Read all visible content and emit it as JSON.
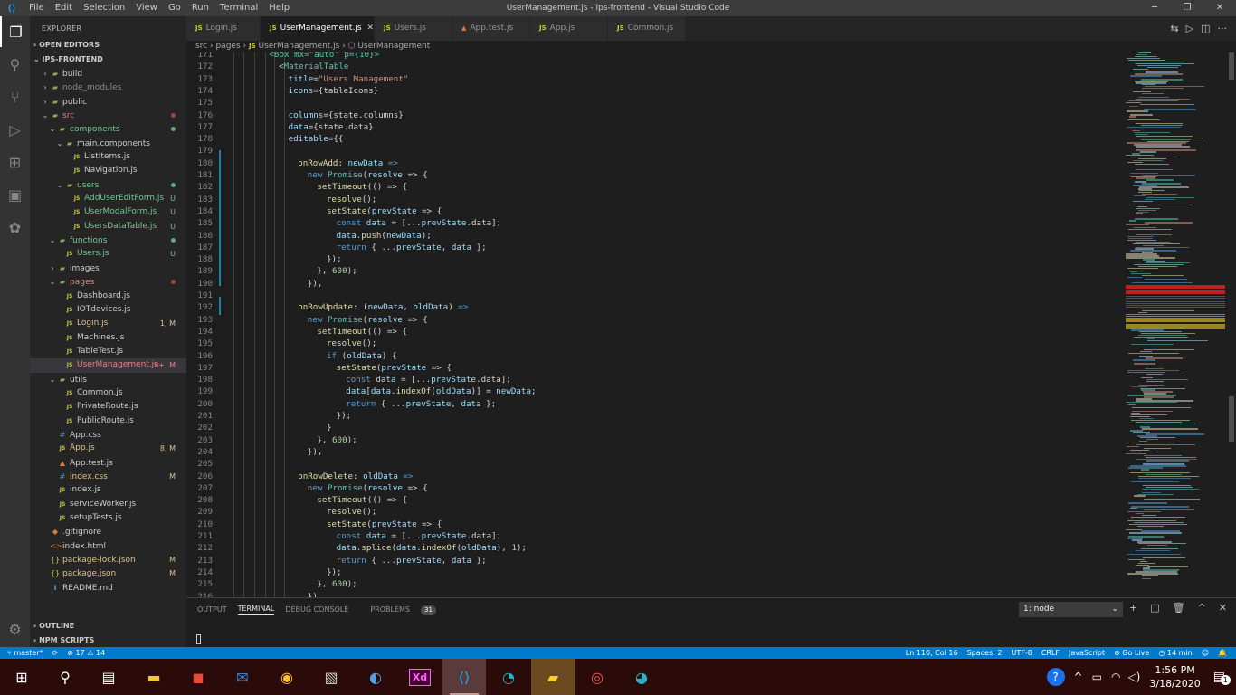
{
  "window": {
    "menu": [
      "File",
      "Edit",
      "Selection",
      "View",
      "Go",
      "Run",
      "Terminal",
      "Help"
    ],
    "title": "UserManagement.js - ips-frontend - Visual Studio Code"
  },
  "explorer": {
    "header": "EXPLORER",
    "open_editors": "OPEN EDITORS",
    "project": "IPS-FRONTEND",
    "outline": "OUTLINE",
    "npm_scripts": "NPM SCRIPTS",
    "tree": [
      {
        "label": "build",
        "type": "folder",
        "depth": 1,
        "open": false,
        "color": "#cccccc",
        "status": ""
      },
      {
        "label": "node_modules",
        "type": "folder",
        "depth": 1,
        "open": false,
        "color": "#8b8b8b",
        "status": ""
      },
      {
        "label": "public",
        "type": "folder",
        "depth": 1,
        "open": false,
        "color": "#cccccc",
        "status": ""
      },
      {
        "label": "src",
        "type": "folder",
        "depth": 1,
        "open": true,
        "color": "#e2817e",
        "status": "dot-red"
      },
      {
        "label": "components",
        "type": "folder",
        "depth": 2,
        "open": true,
        "color": "#73c991",
        "status": "dot-green"
      },
      {
        "label": "main.components",
        "type": "folder",
        "depth": 3,
        "open": true,
        "color": "#cccccc",
        "status": ""
      },
      {
        "label": "ListItems.js",
        "type": "file",
        "depth": 4,
        "color": "#cccccc",
        "status": ""
      },
      {
        "label": "Navigation.js",
        "type": "file",
        "depth": 4,
        "color": "#cccccc",
        "status": ""
      },
      {
        "label": "users",
        "type": "folder",
        "depth": 3,
        "open": true,
        "color": "#73c991",
        "status": "dot-green"
      },
      {
        "label": "AddUserEditForm.js",
        "type": "file",
        "depth": 4,
        "color": "#73c991",
        "status": "U"
      },
      {
        "label": "UserModalForm.js",
        "type": "file",
        "depth": 4,
        "color": "#73c991",
        "status": "U"
      },
      {
        "label": "UsersDataTable.js",
        "type": "file",
        "depth": 4,
        "color": "#73c991",
        "status": "U"
      },
      {
        "label": "functions",
        "type": "folder",
        "depth": 2,
        "open": true,
        "color": "#73c991",
        "status": "dot-green"
      },
      {
        "label": "Users.js",
        "type": "file",
        "depth": 3,
        "color": "#73c991",
        "status": "U"
      },
      {
        "label": "images",
        "type": "folder",
        "depth": 2,
        "open": false,
        "color": "#cccccc",
        "status": ""
      },
      {
        "label": "pages",
        "type": "folder",
        "depth": 2,
        "open": true,
        "color": "#e2817e",
        "status": "dot-red"
      },
      {
        "label": "Dashboard.js",
        "type": "file",
        "depth": 3,
        "color": "#cccccc",
        "status": ""
      },
      {
        "label": "IOTdevices.js",
        "type": "file",
        "depth": 3,
        "color": "#cccccc",
        "status": ""
      },
      {
        "label": "Login.js",
        "type": "file",
        "depth": 3,
        "color": "#e2c08d",
        "status": "1, M"
      },
      {
        "label": "Machines.js",
        "type": "file",
        "depth": 3,
        "color": "#cccccc",
        "status": ""
      },
      {
        "label": "TableTest.js",
        "type": "file",
        "depth": 3,
        "color": "#cccccc",
        "status": ""
      },
      {
        "label": "UserManagement.js",
        "type": "file",
        "depth": 3,
        "color": "#e2817e",
        "status": "9+, M",
        "selected": true
      },
      {
        "label": "utils",
        "type": "folder",
        "depth": 2,
        "open": true,
        "color": "#cccccc",
        "status": ""
      },
      {
        "label": "Common.js",
        "type": "file",
        "depth": 3,
        "color": "#cccccc",
        "status": ""
      },
      {
        "label": "PrivateRoute.js",
        "type": "file",
        "depth": 3,
        "color": "#cccccc",
        "status": ""
      },
      {
        "label": "PublicRoute.js",
        "type": "file",
        "depth": 3,
        "color": "#cccccc",
        "status": ""
      },
      {
        "label": "App.css",
        "type": "file",
        "depth": 2,
        "color": "#cccccc",
        "status": ""
      },
      {
        "label": "App.js",
        "type": "file",
        "depth": 2,
        "color": "#e2c08d",
        "status": "8, M"
      },
      {
        "label": "App.test.js",
        "type": "file",
        "depth": 2,
        "color": "#cccccc",
        "status": ""
      },
      {
        "label": "index.css",
        "type": "file",
        "depth": 2,
        "color": "#e2c08d",
        "status": "M"
      },
      {
        "label": "index.js",
        "type": "file",
        "depth": 2,
        "color": "#cccccc",
        "status": ""
      },
      {
        "label": "serviceWorker.js",
        "type": "file",
        "depth": 2,
        "color": "#cccccc",
        "status": ""
      },
      {
        "label": "setupTests.js",
        "type": "file",
        "depth": 2,
        "color": "#cccccc",
        "status": ""
      },
      {
        "label": ".gitignore",
        "type": "file",
        "depth": 1,
        "color": "#cccccc",
        "status": ""
      },
      {
        "label": "index.html",
        "type": "file",
        "depth": 1,
        "color": "#cccccc",
        "status": ""
      },
      {
        "label": "package-lock.json",
        "type": "file",
        "depth": 1,
        "color": "#e2c08d",
        "status": "M"
      },
      {
        "label": "package.json",
        "type": "file",
        "depth": 1,
        "color": "#e2c08d",
        "status": "M"
      },
      {
        "label": "README.md",
        "type": "file",
        "depth": 1,
        "color": "#cccccc",
        "status": ""
      }
    ]
  },
  "tabs": [
    {
      "label": "Login.js",
      "active": false,
      "warn": false
    },
    {
      "label": "UserManagement.js",
      "active": true,
      "warn": false
    },
    {
      "label": "Users.js",
      "active": false,
      "warn": false
    },
    {
      "label": "App.test.js",
      "active": false,
      "warn": true
    },
    {
      "label": "App.js",
      "active": false,
      "warn": false
    },
    {
      "label": "Common.js",
      "active": false,
      "warn": false
    }
  ],
  "breadcrumb": {
    "parts": [
      "src",
      "pages",
      "UserManagement.js",
      "UserManagement"
    ]
  },
  "code_lines": [
    {
      "n": "171",
      "indent": 4,
      "tokens": [
        [
          "<Box mx=\"auto\" p={10}>",
          "tag"
        ]
      ]
    },
    {
      "n": "172",
      "indent": 5,
      "tokens": [
        [
          "<",
          "plain"
        ],
        [
          "MaterialTable",
          "tag"
        ]
      ]
    },
    {
      "n": "173",
      "indent": 6,
      "tokens": [
        [
          "title",
          "var"
        ],
        [
          "=",
          "plain"
        ],
        [
          "\"Users Management\"",
          "str"
        ]
      ]
    },
    {
      "n": "174",
      "indent": 6,
      "tokens": [
        [
          "icons",
          "var"
        ],
        [
          "={tableIcons}",
          "plain"
        ]
      ]
    },
    {
      "n": "175",
      "indent": 0,
      "tokens": []
    },
    {
      "n": "176",
      "indent": 6,
      "tokens": [
        [
          "columns",
          "var"
        ],
        [
          "={state.columns}",
          "plain"
        ]
      ]
    },
    {
      "n": "177",
      "indent": 6,
      "tokens": [
        [
          "data",
          "var"
        ],
        [
          "={state.data}",
          "plain"
        ]
      ]
    },
    {
      "n": "178",
      "indent": 6,
      "tokens": [
        [
          "editable",
          "var"
        ],
        [
          "={{",
          "plain"
        ]
      ]
    },
    {
      "n": "179",
      "indent": 0,
      "tokens": []
    },
    {
      "n": "180",
      "indent": 7,
      "tokens": [
        [
          "onRowAdd",
          "fn"
        ],
        [
          ": ",
          "plain"
        ],
        [
          "newData",
          "var"
        ],
        [
          " =>",
          "kw"
        ]
      ]
    },
    {
      "n": "181",
      "indent": 8,
      "tokens": [
        [
          "new ",
          "kw"
        ],
        [
          "Promise",
          "tag"
        ],
        [
          "(",
          "plain"
        ],
        [
          "resolve",
          "var"
        ],
        [
          " => {",
          "plain"
        ]
      ]
    },
    {
      "n": "182",
      "indent": 9,
      "tokens": [
        [
          "setTimeout",
          "fn"
        ],
        [
          "(() => {",
          "plain"
        ]
      ]
    },
    {
      "n": "183",
      "indent": 10,
      "tokens": [
        [
          "resolve",
          "fn"
        ],
        [
          "();",
          "plain"
        ]
      ]
    },
    {
      "n": "184",
      "indent": 10,
      "tokens": [
        [
          "setState",
          "fn"
        ],
        [
          "(",
          "plain"
        ],
        [
          "prevState",
          "var"
        ],
        [
          " => {",
          "plain"
        ]
      ]
    },
    {
      "n": "185",
      "indent": 11,
      "tokens": [
        [
          "const ",
          "kw"
        ],
        [
          "data",
          "var"
        ],
        [
          " = [...",
          "plain"
        ],
        [
          "prevState",
          "var"
        ],
        [
          ".data];",
          "plain"
        ]
      ]
    },
    {
      "n": "186",
      "indent": 11,
      "tokens": [
        [
          "data",
          "var"
        ],
        [
          ".",
          "plain"
        ],
        [
          "push",
          "fn"
        ],
        [
          "(",
          "plain"
        ],
        [
          "newData",
          "var"
        ],
        [
          ");",
          "plain"
        ]
      ]
    },
    {
      "n": "187",
      "indent": 11,
      "tokens": [
        [
          "return ",
          "kw"
        ],
        [
          "{ ...",
          "plain"
        ],
        [
          "prevState",
          "var"
        ],
        [
          ", ",
          "plain"
        ],
        [
          "data",
          "var"
        ],
        [
          " };",
          "plain"
        ]
      ]
    },
    {
      "n": "188",
      "indent": 10,
      "tokens": [
        [
          "});",
          "plain"
        ]
      ]
    },
    {
      "n": "189",
      "indent": 9,
      "tokens": [
        [
          "}, ",
          "plain"
        ],
        [
          "600",
          "num"
        ],
        [
          ");",
          "plain"
        ]
      ]
    },
    {
      "n": "190",
      "indent": 8,
      "tokens": [
        [
          "}),",
          "plain"
        ]
      ]
    },
    {
      "n": "191",
      "indent": 0,
      "tokens": []
    },
    {
      "n": "192",
      "indent": 7,
      "tokens": [
        [
          "onRowUpdate",
          "fn"
        ],
        [
          ": (",
          "plain"
        ],
        [
          "newData",
          "var"
        ],
        [
          ", ",
          "plain"
        ],
        [
          "oldData",
          "var"
        ],
        [
          ") ",
          "plain"
        ],
        [
          "=>",
          "kw"
        ]
      ]
    },
    {
      "n": "193",
      "indent": 8,
      "tokens": [
        [
          "new ",
          "kw"
        ],
        [
          "Promise",
          "tag"
        ],
        [
          "(",
          "plain"
        ],
        [
          "resolve",
          "var"
        ],
        [
          " => {",
          "plain"
        ]
      ]
    },
    {
      "n": "194",
      "indent": 9,
      "tokens": [
        [
          "setTimeout",
          "fn"
        ],
        [
          "(() => {",
          "plain"
        ]
      ]
    },
    {
      "n": "195",
      "indent": 10,
      "tokens": [
        [
          "resolve",
          "fn"
        ],
        [
          "();",
          "plain"
        ]
      ]
    },
    {
      "n": "196",
      "indent": 10,
      "tokens": [
        [
          "if ",
          "kw"
        ],
        [
          "(",
          "plain"
        ],
        [
          "oldData",
          "var"
        ],
        [
          ") {",
          "plain"
        ]
      ]
    },
    {
      "n": "197",
      "indent": 11,
      "tokens": [
        [
          "setState",
          "fn"
        ],
        [
          "(",
          "plain"
        ],
        [
          "prevState",
          "var"
        ],
        [
          " => {",
          "plain"
        ]
      ]
    },
    {
      "n": "198",
      "indent": 12,
      "tokens": [
        [
          "const ",
          "kw"
        ],
        [
          "data",
          "var"
        ],
        [
          " = [...",
          "plain"
        ],
        [
          "prevState",
          "var"
        ],
        [
          ".data];",
          "plain"
        ]
      ]
    },
    {
      "n": "199",
      "indent": 12,
      "tokens": [
        [
          "data",
          "var"
        ],
        [
          "[",
          "plain"
        ],
        [
          "data",
          "var"
        ],
        [
          ".",
          "plain"
        ],
        [
          "indexOf",
          "fn"
        ],
        [
          "(",
          "plain"
        ],
        [
          "oldData",
          "var"
        ],
        [
          ")] = ",
          "plain"
        ],
        [
          "newData",
          "var"
        ],
        [
          ";",
          "plain"
        ]
      ]
    },
    {
      "n": "200",
      "indent": 12,
      "tokens": [
        [
          "return ",
          "kw"
        ],
        [
          "{ ...",
          "plain"
        ],
        [
          "prevState",
          "var"
        ],
        [
          ", ",
          "plain"
        ],
        [
          "data",
          "var"
        ],
        [
          " };",
          "plain"
        ]
      ]
    },
    {
      "n": "201",
      "indent": 11,
      "tokens": [
        [
          "});",
          "plain"
        ]
      ]
    },
    {
      "n": "202",
      "indent": 10,
      "tokens": [
        [
          "}",
          "plain"
        ]
      ]
    },
    {
      "n": "203",
      "indent": 9,
      "tokens": [
        [
          "}, ",
          "plain"
        ],
        [
          "600",
          "num"
        ],
        [
          ");",
          "plain"
        ]
      ]
    },
    {
      "n": "204",
      "indent": 8,
      "tokens": [
        [
          "}),",
          "plain"
        ]
      ]
    },
    {
      "n": "205",
      "indent": 0,
      "tokens": []
    },
    {
      "n": "206",
      "indent": 7,
      "tokens": [
        [
          "onRowDelete",
          "fn"
        ],
        [
          ": ",
          "plain"
        ],
        [
          "oldData",
          "var"
        ],
        [
          " =>",
          "kw"
        ]
      ]
    },
    {
      "n": "207",
      "indent": 8,
      "tokens": [
        [
          "new ",
          "kw"
        ],
        [
          "Promise",
          "tag"
        ],
        [
          "(",
          "plain"
        ],
        [
          "resolve",
          "var"
        ],
        [
          " => {",
          "plain"
        ]
      ]
    },
    {
      "n": "208",
      "indent": 9,
      "tokens": [
        [
          "setTimeout",
          "fn"
        ],
        [
          "(() => {",
          "plain"
        ]
      ]
    },
    {
      "n": "209",
      "indent": 10,
      "tokens": [
        [
          "resolve",
          "fn"
        ],
        [
          "();",
          "plain"
        ]
      ]
    },
    {
      "n": "210",
      "indent": 10,
      "tokens": [
        [
          "setState",
          "fn"
        ],
        [
          "(",
          "plain"
        ],
        [
          "prevState",
          "var"
        ],
        [
          " => {",
          "plain"
        ]
      ]
    },
    {
      "n": "211",
      "indent": 11,
      "tokens": [
        [
          "const ",
          "kw"
        ],
        [
          "data",
          "var"
        ],
        [
          " = [...",
          "plain"
        ],
        [
          "prevState",
          "var"
        ],
        [
          ".data];",
          "plain"
        ]
      ]
    },
    {
      "n": "212",
      "indent": 11,
      "tokens": [
        [
          "data",
          "var"
        ],
        [
          ".",
          "plain"
        ],
        [
          "splice",
          "fn"
        ],
        [
          "(",
          "plain"
        ],
        [
          "data",
          "var"
        ],
        [
          ".",
          "plain"
        ],
        [
          "indexOf",
          "fn"
        ],
        [
          "(",
          "plain"
        ],
        [
          "oldData",
          "var"
        ],
        [
          "), ",
          "plain"
        ],
        [
          "1",
          "num"
        ],
        [
          ");",
          "plain"
        ]
      ]
    },
    {
      "n": "213",
      "indent": 11,
      "tokens": [
        [
          "return ",
          "kw"
        ],
        [
          "{ ...",
          "plain"
        ],
        [
          "prevState",
          "var"
        ],
        [
          ", ",
          "plain"
        ],
        [
          "data",
          "var"
        ],
        [
          " };",
          "plain"
        ]
      ]
    },
    {
      "n": "214",
      "indent": 10,
      "tokens": [
        [
          "});",
          "plain"
        ]
      ]
    },
    {
      "n": "215",
      "indent": 9,
      "tokens": [
        [
          "}, ",
          "plain"
        ],
        [
          "600",
          "num"
        ],
        [
          ");",
          "plain"
        ]
      ]
    },
    {
      "n": "216",
      "indent": 8,
      "tokens": [
        [
          "}),",
          "plain"
        ]
      ]
    }
  ],
  "panel": {
    "tabs": [
      "OUTPUT",
      "TERMINAL",
      "DEBUG CONSOLE",
      "PROBLEMS"
    ],
    "active_tab": "TERMINAL",
    "problems_count": "31",
    "terminal_select": "1: node"
  },
  "statusbar": {
    "branch": "master*",
    "errors": "17",
    "warnings": "14",
    "position": "Ln 110, Col 16",
    "spaces": "Spaces: 2",
    "encoding": "UTF-8",
    "eol": "CRLF",
    "language": "JavaScript",
    "golive": "Go Live",
    "timer": "14 min"
  },
  "taskbar": {
    "time": "1:56 PM",
    "date": "3/18/2020",
    "notification_count": "1",
    "apps": [
      "windows-start-icon",
      "search-icon",
      "task-view-icon",
      "file-explorer-icon",
      "microsoft-store-icon",
      "mail-icon",
      "chrome-icon",
      "photo-viewer-icon",
      "messaging-icon",
      "adobe-xd-icon",
      "vscode-icon",
      "edge-icon",
      "sticky-notes-icon",
      "swirl-app-icon",
      "edge-dev-icon"
    ]
  },
  "colors": {
    "accent": "#007acc",
    "keyword": "#569cd6",
    "function": "#dcdcaa",
    "string": "#ce9178",
    "variable": "#9cdcfe",
    "type": "#4ec9b0"
  }
}
